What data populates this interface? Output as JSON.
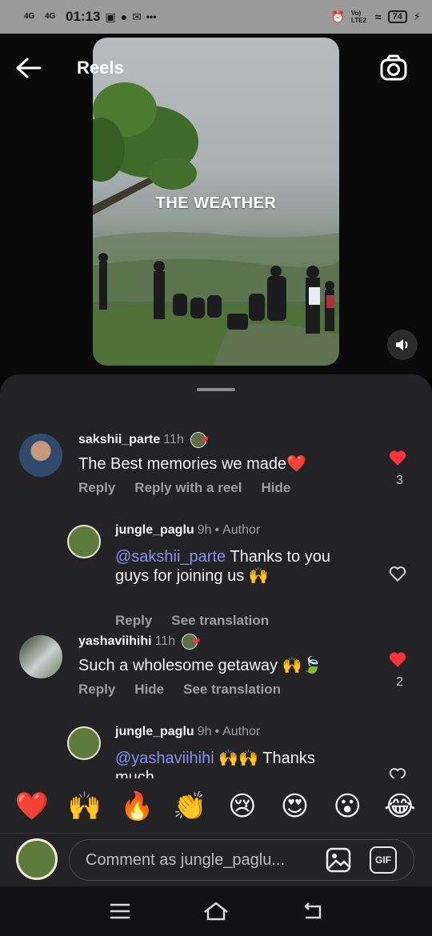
{
  "status_bar": {
    "network_1": "4G",
    "network_2": "4G",
    "time": "01:13",
    "more": "•••",
    "volte": "Vo) LTE2",
    "battery": "74"
  },
  "header": {
    "title": "Reels"
  },
  "reel": {
    "overlay_text": "THE WEATHER"
  },
  "comments": [
    {
      "username": "sakshii_parte",
      "time": "11h",
      "text": "The Best memories we made❤️",
      "actions": [
        "Reply",
        "Reply with a reel",
        "Hide"
      ],
      "liked": true,
      "like_count": "3"
    },
    {
      "username": "jungle_paglu",
      "time": "9h",
      "badge": "Author",
      "mention": "@sakshii_parte",
      "text": " Thanks to you guys for joining us 🙌",
      "actions": [
        "Reply",
        "See translation"
      ],
      "liked": false
    },
    {
      "username": "yashaviihihi",
      "time": "11h",
      "text": "Such a wholesome getaway 🙌🍃",
      "actions": [
        "Reply",
        "Hide",
        "See translation"
      ],
      "liked": true,
      "like_count": "2"
    },
    {
      "username": "jungle_paglu",
      "time": "9h",
      "badge": "Author",
      "mention": "@yashaviihihi",
      "text": " 🙌🙌 Thanks much",
      "liked": false
    }
  ],
  "emoji_bar": [
    "❤️",
    "🙌",
    "🔥",
    "👏",
    "😢",
    "😍",
    "😮",
    "😂"
  ],
  "composer": {
    "placeholder": "Comment as jungle_paglu...",
    "gif_label": "GIF"
  },
  "colors": {
    "sheet_bg": "#232326",
    "like_red": "#ff3040",
    "mention_blue": "#8b8ef0",
    "muted_text": "#9d9da2"
  }
}
